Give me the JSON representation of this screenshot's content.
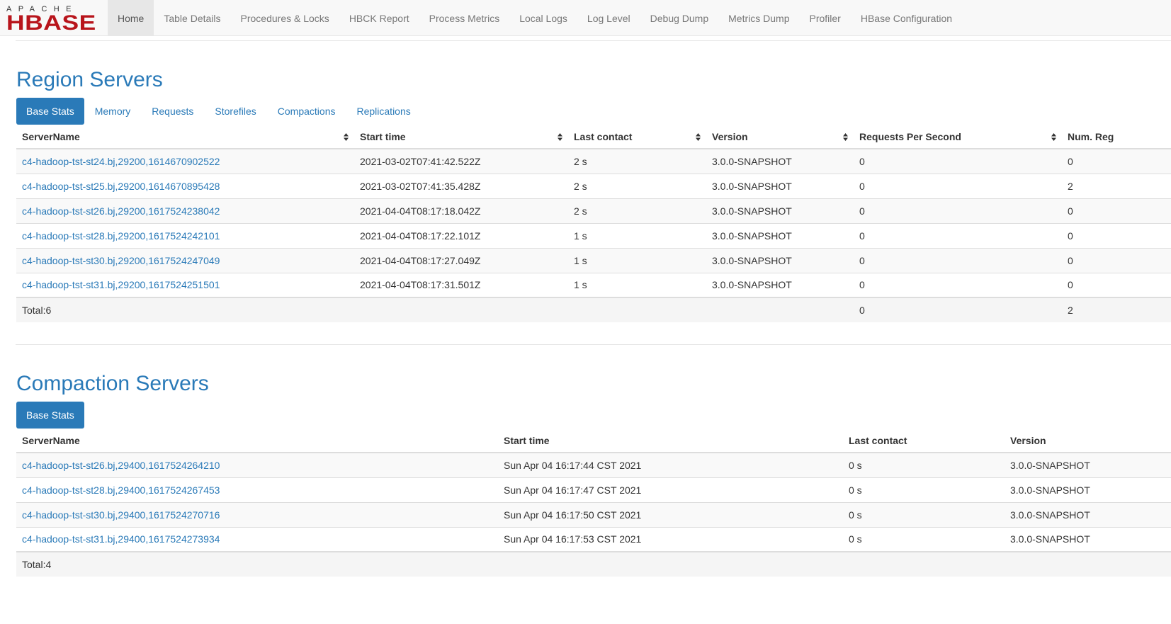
{
  "logo": {
    "top": "APACHE",
    "bottom": "HBASE"
  },
  "nav": [
    "Home",
    "Table Details",
    "Procedures & Locks",
    "HBCK Report",
    "Process Metrics",
    "Local Logs",
    "Log Level",
    "Debug Dump",
    "Metrics Dump",
    "Profiler",
    "HBase Configuration"
  ],
  "region_servers": {
    "title": "Region Servers",
    "tabs": [
      "Base Stats",
      "Memory",
      "Requests",
      "Storefiles",
      "Compactions",
      "Replications"
    ],
    "columns": [
      "ServerName",
      "Start time",
      "Last contact",
      "Version",
      "Requests Per Second",
      "Num. Reg"
    ],
    "rows": [
      [
        "c4-hadoop-tst-st24.bj,29200,1614670902522",
        "2021-03-02T07:41:42.522Z",
        "2 s",
        "3.0.0-SNAPSHOT",
        "0",
        "0"
      ],
      [
        "c4-hadoop-tst-st25.bj,29200,1614670895428",
        "2021-03-02T07:41:35.428Z",
        "2 s",
        "3.0.0-SNAPSHOT",
        "0",
        "2"
      ],
      [
        "c4-hadoop-tst-st26.bj,29200,1617524238042",
        "2021-04-04T08:17:18.042Z",
        "2 s",
        "3.0.0-SNAPSHOT",
        "0",
        "0"
      ],
      [
        "c4-hadoop-tst-st28.bj,29200,1617524242101",
        "2021-04-04T08:17:22.101Z",
        "1 s",
        "3.0.0-SNAPSHOT",
        "0",
        "0"
      ],
      [
        "c4-hadoop-tst-st30.bj,29200,1617524247049",
        "2021-04-04T08:17:27.049Z",
        "1 s",
        "3.0.0-SNAPSHOT",
        "0",
        "0"
      ],
      [
        "c4-hadoop-tst-st31.bj,29200,1617524251501",
        "2021-04-04T08:17:31.501Z",
        "1 s",
        "3.0.0-SNAPSHOT",
        "0",
        "0"
      ]
    ],
    "total": {
      "label": "Total:6",
      "requests": "0",
      "regions": "2"
    }
  },
  "compaction_servers": {
    "title": "Compaction Servers",
    "tabs": [
      "Base Stats"
    ],
    "columns": [
      "ServerName",
      "Start time",
      "Last contact",
      "Version"
    ],
    "rows": [
      [
        "c4-hadoop-tst-st26.bj,29400,1617524264210",
        "Sun Apr 04 16:17:44 CST 2021",
        "0 s",
        "3.0.0-SNAPSHOT"
      ],
      [
        "c4-hadoop-tst-st28.bj,29400,1617524267453",
        "Sun Apr 04 16:17:47 CST 2021",
        "0 s",
        "3.0.0-SNAPSHOT"
      ],
      [
        "c4-hadoop-tst-st30.bj,29400,1617524270716",
        "Sun Apr 04 16:17:50 CST 2021",
        "0 s",
        "3.0.0-SNAPSHOT"
      ],
      [
        "c4-hadoop-tst-st31.bj,29400,1617524273934",
        "Sun Apr 04 16:17:53 CST 2021",
        "0 s",
        "3.0.0-SNAPSHOT"
      ]
    ],
    "total": {
      "label": "Total:4"
    }
  }
}
